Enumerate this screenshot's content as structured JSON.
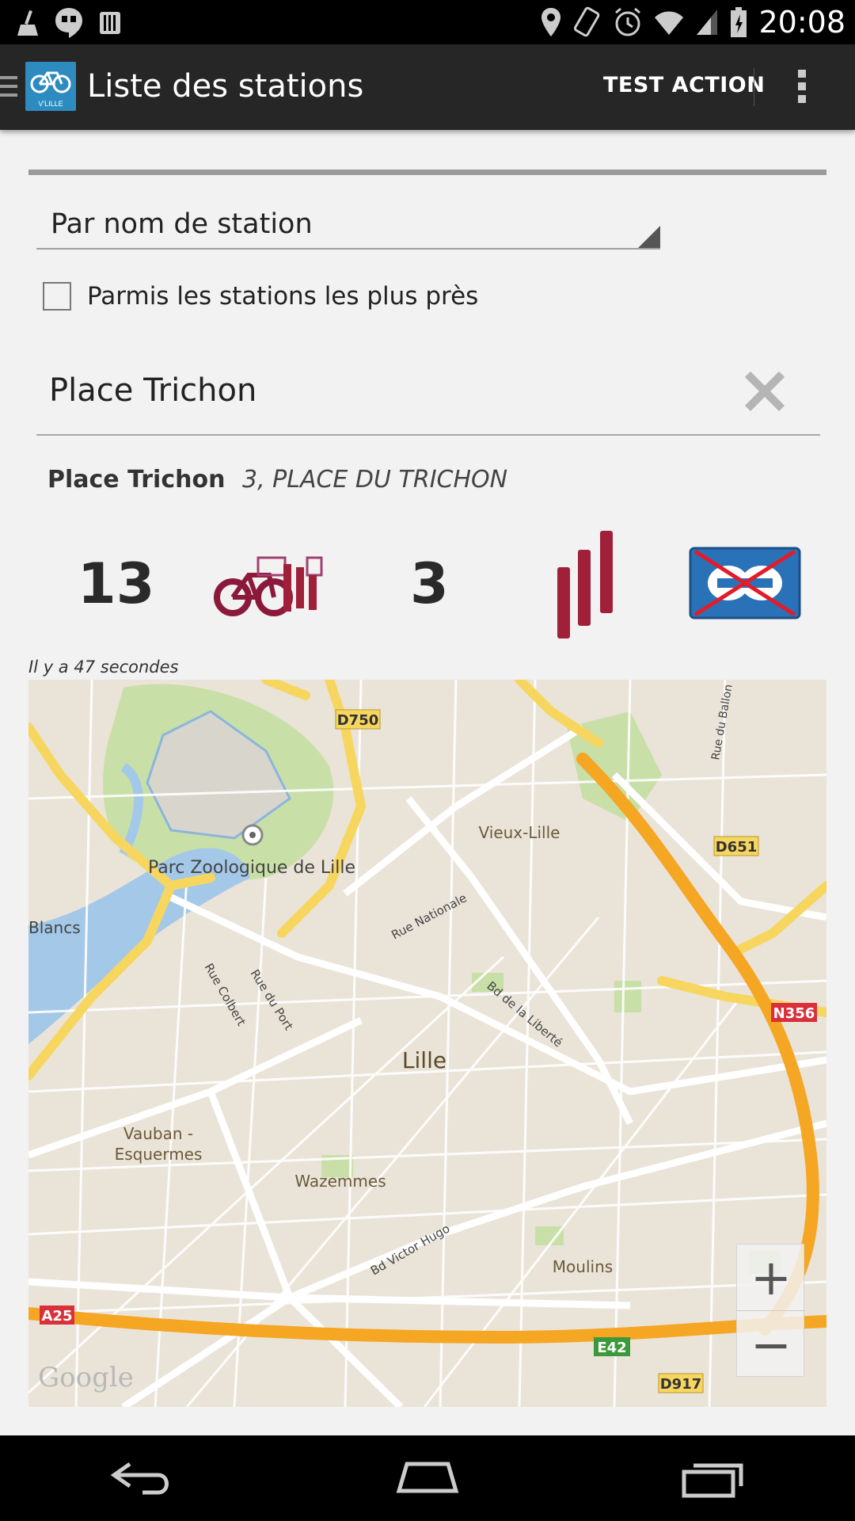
{
  "status_bar": {
    "time": "20:08",
    "left_icons": [
      "broom-icon",
      "hangouts-icon",
      "barcode-icon"
    ],
    "right_icons": [
      "location-icon",
      "rotate-icon",
      "alarm-icon",
      "wifi-icon",
      "signal-icon",
      "battery-icon"
    ]
  },
  "action_bar": {
    "app_icon_label": "V'LILLE",
    "title": "Liste des stations",
    "action_label": "TEST ACTION",
    "overflow_icon": "overflow-icon"
  },
  "form": {
    "spinner_value": "Par nom de station",
    "checkbox_label": "Parmis les stations les plus près",
    "checkbox_checked": false,
    "search_value": "Place Trichon",
    "search_placeholder": ""
  },
  "station": {
    "name": "Place Trichon",
    "address": "3, PLACE DU TRICHON",
    "bikes_available": "13",
    "stands_available": "3",
    "cb_accepted": false,
    "updated": "Il y a 47 secondes",
    "bike_color": "#8b1a3a",
    "stand_color": "#a0203a"
  },
  "map": {
    "labels": {
      "d750": "D750",
      "d651": "D651",
      "n356": "N356",
      "a25": "A25",
      "e42": "E42",
      "d917": "D917",
      "parc": "Parc Zoologique de Lille",
      "vieux_lille": "Vieux-Lille",
      "blancs": "Blancs",
      "rue_nationale": "Rue Nationale",
      "rue_colbert": "Rue Colbert",
      "rue_du_port": "Rue du Port",
      "bd_liberte": "Bd de la Liberté",
      "lille": "Lille",
      "vauban_1": "Vauban -",
      "vauban_2": "Esquermes",
      "wazemmes": "Wazemmes",
      "bd_victor_hugo": "Bd Victor Hugo",
      "moulins": "Moulins",
      "rue_du_ballon": "Rue du Ballon",
      "google": "Google"
    },
    "zoom_in": "+",
    "zoom_out": "−",
    "colors": {
      "land": "#eae3d8",
      "park": "#c9dfa8",
      "water": "#a4c8e8",
      "highway": "#f5a623",
      "primary": "#f7d660",
      "road": "#ffffff"
    }
  },
  "nav_bar": {
    "back_icon": "back-icon",
    "home_icon": "home-icon",
    "recents_icon": "recents-icon"
  }
}
